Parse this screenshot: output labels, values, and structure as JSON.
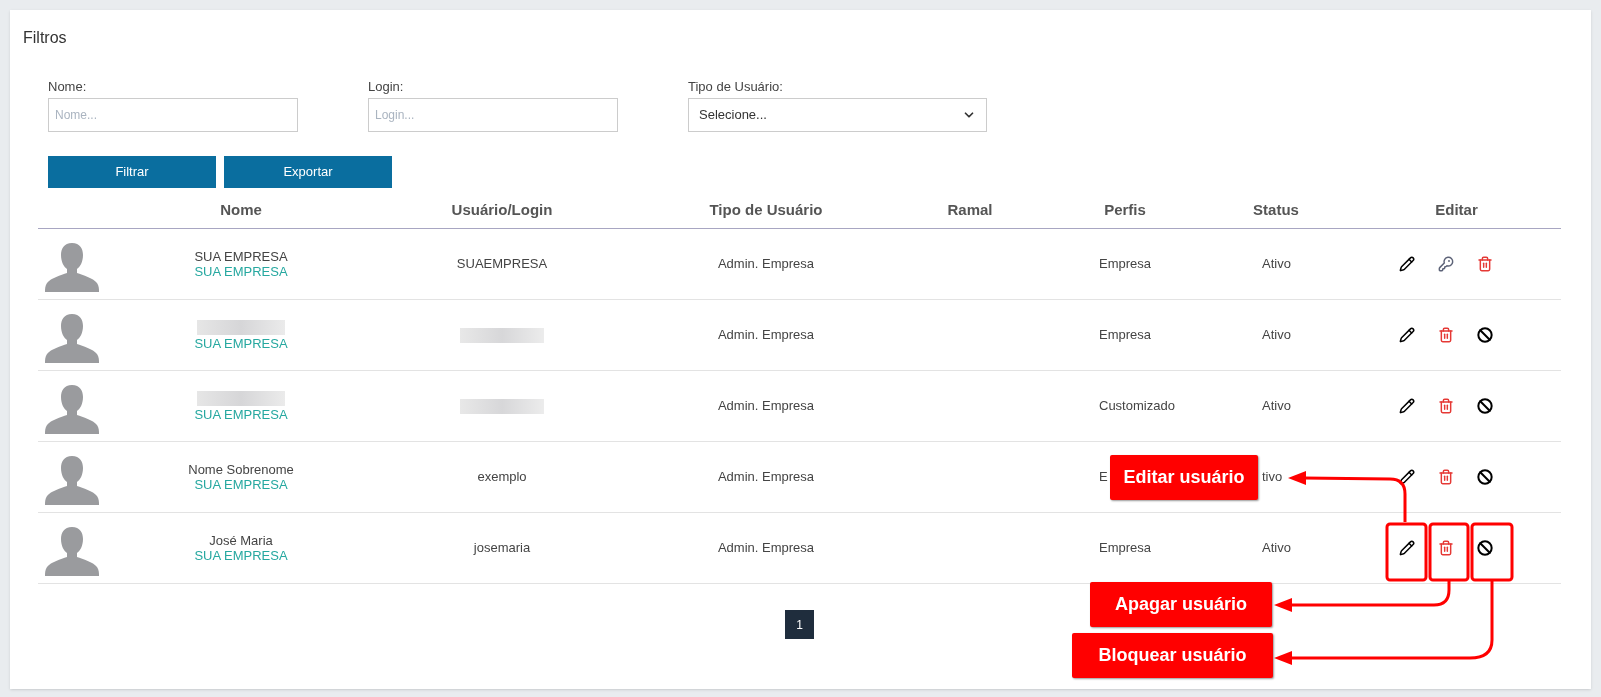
{
  "filters": {
    "title": "Filtros",
    "fields": [
      {
        "kind": "text",
        "label": "Nome:",
        "placeholder": "Nome..."
      },
      {
        "kind": "text",
        "label": "Login:",
        "placeholder": "Login..."
      },
      {
        "kind": "select",
        "label": "Tipo de Usuário:",
        "value": "Selecione..."
      }
    ],
    "buttons": [
      "Filtrar",
      "Exportar"
    ]
  },
  "table": {
    "columns": [
      "Nome",
      "Usuário/Login",
      "Tipo de Usuário",
      "Ramal",
      "Perfis",
      "Status",
      "Editar"
    ],
    "rows": [
      {
        "redacted": false,
        "name": "SUA EMPRESA",
        "company": "SUA EMPRESA",
        "login": "SUAEMPRESA",
        "type": "Admin. Empresa",
        "profile": "Empresa",
        "status": "Ativo",
        "actions": [
          {
            "kind": "edit"
          },
          {
            "kind": "key"
          },
          {
            "kind": "delete"
          }
        ]
      },
      {
        "redacted": true,
        "company": "SUA EMPRESA",
        "type": "Admin. Empresa",
        "profile": "Empresa",
        "status": "Ativo",
        "actions": [
          {
            "kind": "edit"
          },
          {
            "kind": "delete"
          },
          {
            "kind": "block"
          }
        ]
      },
      {
        "redacted": true,
        "company": "SUA EMPRESA",
        "type": "Admin. Empresa",
        "profile": "Customizado",
        "status": "Ativo",
        "actions": [
          {
            "kind": "edit"
          },
          {
            "kind": "delete"
          },
          {
            "kind": "block"
          }
        ]
      },
      {
        "redacted": false,
        "name": "Nome Sobrenome",
        "company": "SUA EMPRESA",
        "login": "exemplo",
        "type": "Admin. Empresa",
        "profile": "E",
        "status": "tivo",
        "actions": [
          {
            "kind": "edit"
          },
          {
            "kind": "delete"
          },
          {
            "kind": "block"
          }
        ]
      },
      {
        "redacted": false,
        "name": "José Maria",
        "company": "SUA EMPRESA",
        "login": "josemaria",
        "type": "Admin. Empresa",
        "profile": "Empresa",
        "status": "Ativo",
        "actions": [
          {
            "kind": "edit"
          },
          {
            "kind": "delete"
          },
          {
            "kind": "block"
          }
        ]
      }
    ]
  },
  "pagination": {
    "pages": [
      {
        "label": "1",
        "selected": true
      }
    ]
  },
  "annotations": [
    {
      "kind": "edit",
      "label": "Editar usuário"
    },
    {
      "kind": "delete",
      "label": "Apagar usuário"
    },
    {
      "kind": "block",
      "label": "Bloquear usuário"
    }
  ]
}
